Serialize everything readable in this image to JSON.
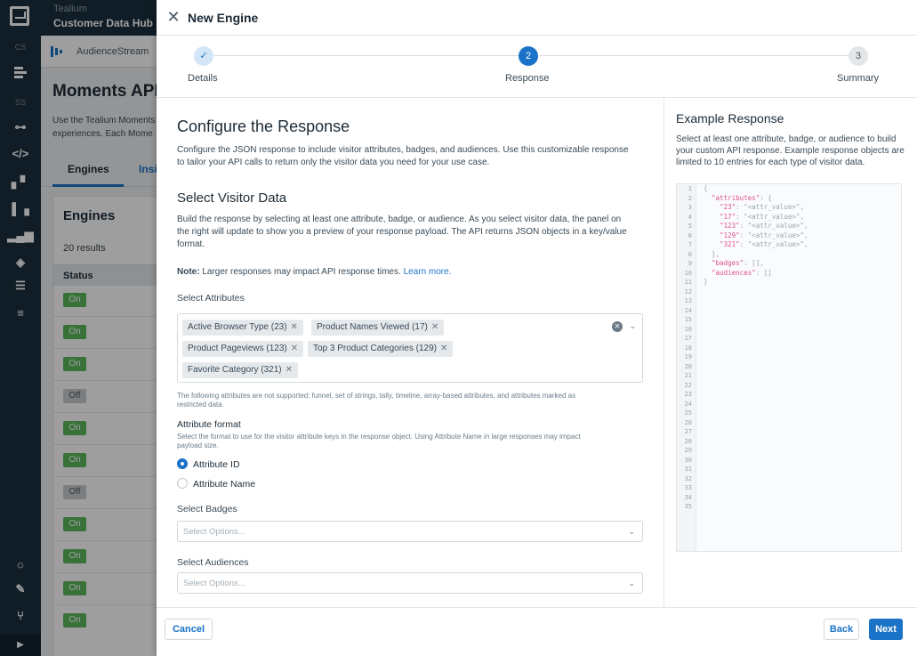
{
  "brand": {
    "line1": "Tealium",
    "line2": "Customer Data Hub"
  },
  "rail": {
    "label_cs": "CS",
    "label_ss": "SS"
  },
  "bg": {
    "crumb": "AudienceStream",
    "title": "Moments API",
    "desc_line1": "Use the Tealium Moments",
    "desc_line2": "experiences. Each Mome",
    "tab_engines": "Engines",
    "tab_insights": "Insi",
    "card_title": "Engines",
    "results": "20 results",
    "status_header": "Status",
    "statuses": [
      "On",
      "On",
      "On",
      "Off",
      "On",
      "On",
      "Off",
      "On",
      "On",
      "On",
      "On"
    ]
  },
  "modal": {
    "title": "New Engine",
    "steps": [
      {
        "number": "✓",
        "label": "Details"
      },
      {
        "number": "2",
        "label": "Response"
      },
      {
        "number": "3",
        "label": "Summary"
      }
    ],
    "heading": "Configure the Response",
    "intro_l1": "Configure the JSON response to include visitor attributes, badges, and audiences. Use this customizable response",
    "intro_l2": "to tailor your API calls to return only the visitor data you need for your use case.",
    "select_heading": "Select Visitor Data",
    "select_l1": "Build the response by selecting at least one attribute, badge, or audience. As you select visitor data, the panel on",
    "select_l2": "the right will update to show you a preview of your response payload. The API returns JSON objects in a key/value",
    "select_l3": "format.",
    "note_bold": "Note:",
    "note_text": "Larger responses may impact API response times.",
    "note_link": "Learn more.",
    "attributes_label": "Select Attributes",
    "tags": [
      "Active Browser Type (23)",
      "Product Names Viewed (17)",
      "Product Pageviews (123)",
      "Top 3 Product Categories (129)",
      "Favorite Category (321)"
    ],
    "unsupported_l1": "The following attributes are not supported: funnel, set of strings, tally, timeline, array-based attributes, and attributes marked as",
    "unsupported_l2": "restricted data.",
    "format_label": "Attribute format",
    "format_desc_l1": "Select the format to use for the visitor attribute keys in the response object. Using Attribute Name in large responses may impact",
    "format_desc_l2": "payload size.",
    "radio_id": "Attribute ID",
    "radio_name": "Attribute Name",
    "badges_label": "Select Badges",
    "badges_placeholder": "Select Options...",
    "audiences_label": "Select Audiences",
    "audiences_placeholder": "Select Options...",
    "example_title": "Example Response",
    "example_desc": "Select at least one attribute, badge, or audience to build your custom API response. Example response objects are limited to 10 entries for each type of visitor data.",
    "code_lines": [
      "{",
      "  \"attributes\": {",
      "    \"23\": \"<attr_value>\",",
      "    \"17\": \"<attr_value>\",",
      "    \"123\": \"<attr_value>\",",
      "    \"129\": \"<attr_value>\",",
      "    \"321\": \"<attr_value>\",",
      "  },",
      "  \"badges\": [],",
      "  \"audiences\": []",
      "}"
    ],
    "code_line_count": 35,
    "cancel": "Cancel",
    "back": "Back",
    "next": "Next"
  },
  "colors": {
    "accent": "#1a73c7",
    "rail": "#1b2f3e",
    "on": "#5cb85c"
  }
}
